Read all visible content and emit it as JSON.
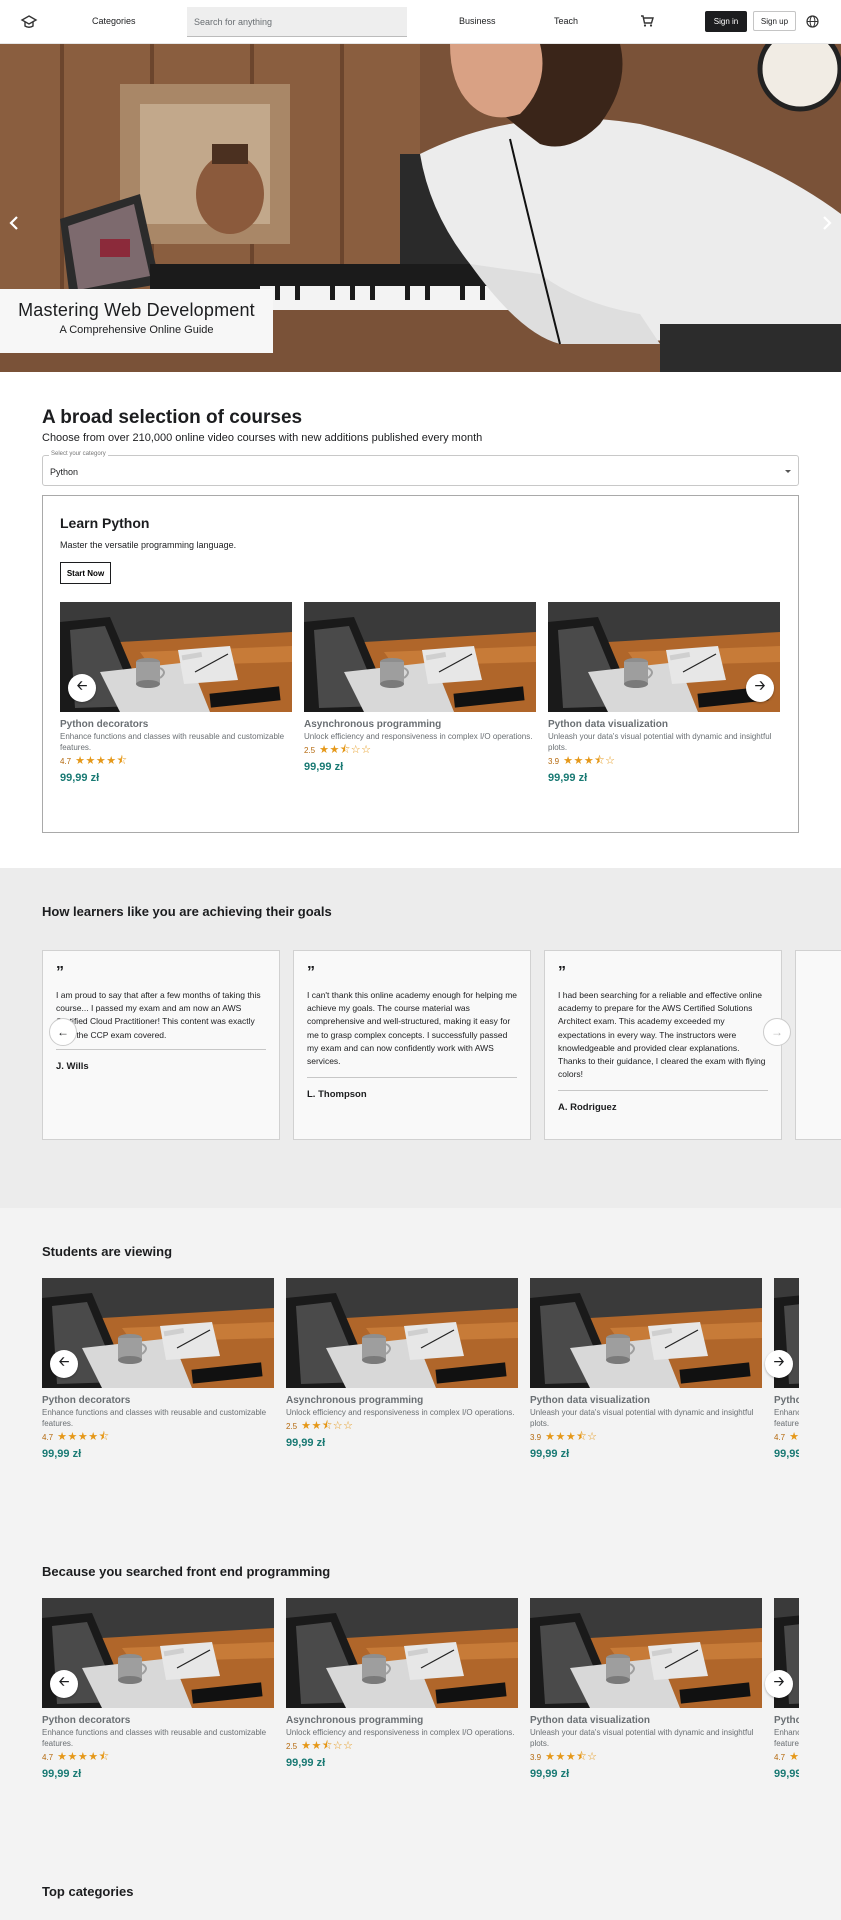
{
  "nav": {
    "categories": "Categories",
    "search_placeholder": "Search for anything",
    "business": "Business",
    "teach": "Teach",
    "sign_in": "Sign in",
    "sign_up": "Sign up",
    "icons": [
      "logo-icon",
      "cart-icon",
      "globe-icon"
    ]
  },
  "hero": {
    "title": "Mastering Web Development",
    "subtitle": "A Comprehensive Online Guide"
  },
  "broad": {
    "heading": "A broad selection of courses",
    "subheading": "Choose from over 210,000 online video courses with new additions published every month",
    "select_label": "Select your category",
    "select_value": "Python",
    "learn_title": "Learn Python",
    "learn_desc": "Master the versatile programming language.",
    "start_label": "Start Now"
  },
  "courses": [
    {
      "title": "Python decorators",
      "desc": "Enhance functions and classes with reusable and customizable features.",
      "rating": "4.7",
      "stars": 4.5,
      "price": "99,99 zł"
    },
    {
      "title": "Asynchronous programming",
      "desc": "Unlock efficiency and responsiveness in complex I/O operations.",
      "rating": "2.5",
      "stars": 2.5,
      "price": "99,99 zł"
    },
    {
      "title": "Python data visualization",
      "desc": "Unleash your data's visual potential with dynamic and insightful plots.",
      "rating": "3.9",
      "stars": 3.5,
      "price": "99,99 zł"
    }
  ],
  "testimonials": {
    "heading": "How learners like you are achieving their goals",
    "items": [
      {
        "text": "I am proud to say that after a few months of taking this course... I passed my exam and am now an AWS Certified Cloud Practitioner! This content was exactly what the CCP exam covered.",
        "name": "J. Wills"
      },
      {
        "text": "I can't thank this online academy enough for helping me achieve my goals. The course material was comprehensive and well-structured, making it easy for me to grasp complex concepts. I successfully passed my exam and can now confidently work with AWS services.",
        "name": "L. Thompson"
      },
      {
        "text": "I had been searching for a reliable and effective online academy to prepare for the AWS Certified Solutions Architect exam. This academy exceeded my expectations in every way. The instructors were knowledgeable and provided clear explanations. Thanks to their guidance, I cleared the exam with flying colors!",
        "name": "A. Rodriguez"
      }
    ]
  },
  "sections": {
    "students_viewing": "Students are viewing",
    "because_searched": "Because you searched front end programming",
    "top_categories": "Top categories"
  },
  "colors": {
    "accent_price": "#1a7a74",
    "rating_text": "#b4690e",
    "star": "#e59819",
    "button_dark": "#1c1d1f"
  }
}
